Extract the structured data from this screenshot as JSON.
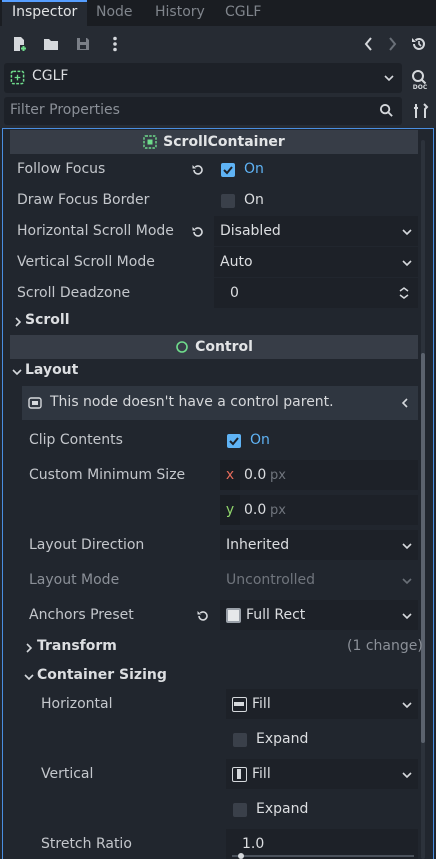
{
  "tabs": [
    "Inspector",
    "Node",
    "History",
    "CGLF"
  ],
  "object": {
    "name": "CGLF"
  },
  "filter": {
    "placeholder": "Filter Properties"
  },
  "sections": {
    "scroll_container": {
      "title": "ScrollContainer",
      "follow_focus": {
        "label": "Follow Focus",
        "value": "On",
        "checked": true
      },
      "draw_focus_border": {
        "label": "Draw Focus Border",
        "value": "On",
        "checked": false
      },
      "horizontal_scroll_mode": {
        "label": "Horizontal Scroll Mode",
        "value": "Disabled"
      },
      "vertical_scroll_mode": {
        "label": "Vertical Scroll Mode",
        "value": "Auto"
      },
      "scroll_deadzone": {
        "label": "Scroll Deadzone",
        "value": "0"
      },
      "scroll_group": "Scroll"
    },
    "control": {
      "title": "Control",
      "layout_group": "Layout",
      "notice": "This node doesn't have a control parent.",
      "clip_contents": {
        "label": "Clip Contents",
        "value": "On",
        "checked": true
      },
      "custom_min_size": {
        "label": "Custom Minimum Size",
        "x_axis": "x",
        "x": "0.0",
        "y_axis": "y",
        "y": "0.0",
        "unit": "px"
      },
      "layout_direction": {
        "label": "Layout Direction",
        "value": "Inherited"
      },
      "layout_mode": {
        "label": "Layout Mode",
        "value": "Uncontrolled"
      },
      "anchors_preset": {
        "label": "Anchors Preset",
        "value": "Full Rect"
      },
      "transform": {
        "label": "Transform",
        "changes": "(1 change)"
      },
      "container_sizing": {
        "label": "Container Sizing",
        "horizontal": {
          "label": "Horizontal",
          "value": "Fill",
          "expand": "Expand",
          "expand_checked": false
        },
        "vertical": {
          "label": "Vertical",
          "value": "Fill",
          "expand": "Expand",
          "expand_checked": false
        },
        "stretch_ratio": {
          "label": "Stretch Ratio",
          "value": "1.0"
        }
      }
    }
  },
  "colors": {
    "accent": "#5fb3f5",
    "panel_border": "#4a8ee0",
    "background": "#21262e"
  }
}
